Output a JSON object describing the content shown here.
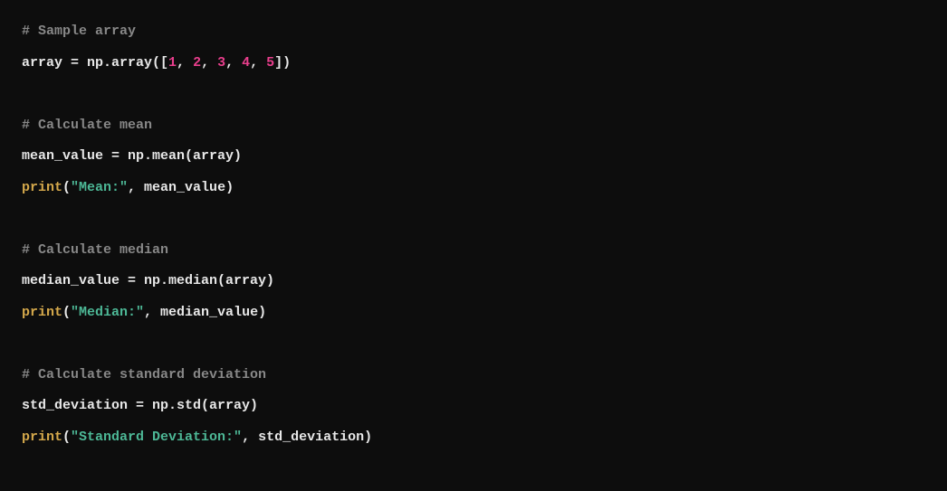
{
  "code": {
    "lines": [
      {
        "type": "comment",
        "content": "# Sample array"
      },
      {
        "type": "mixed",
        "tokens": [
          {
            "c": "default",
            "t": "array = np.array(["
          },
          {
            "c": "number",
            "t": "1"
          },
          {
            "c": "default",
            "t": ", "
          },
          {
            "c": "number",
            "t": "2"
          },
          {
            "c": "default",
            "t": ", "
          },
          {
            "c": "number",
            "t": "3"
          },
          {
            "c": "default",
            "t": ", "
          },
          {
            "c": "number",
            "t": "4"
          },
          {
            "c": "default",
            "t": ", "
          },
          {
            "c": "number",
            "t": "5"
          },
          {
            "c": "default",
            "t": "])"
          }
        ]
      },
      {
        "type": "blank"
      },
      {
        "type": "comment",
        "content": "# Calculate mean"
      },
      {
        "type": "mixed",
        "tokens": [
          {
            "c": "default",
            "t": "mean_value = np.mean(array)"
          }
        ]
      },
      {
        "type": "mixed",
        "tokens": [
          {
            "c": "builtin",
            "t": "print"
          },
          {
            "c": "default",
            "t": "("
          },
          {
            "c": "string",
            "t": "\"Mean:\""
          },
          {
            "c": "default",
            "t": ", mean_value)"
          }
        ]
      },
      {
        "type": "blank"
      },
      {
        "type": "comment",
        "content": "# Calculate median"
      },
      {
        "type": "mixed",
        "tokens": [
          {
            "c": "default",
            "t": "median_value = np.median(array)"
          }
        ]
      },
      {
        "type": "mixed",
        "tokens": [
          {
            "c": "builtin",
            "t": "print"
          },
          {
            "c": "default",
            "t": "("
          },
          {
            "c": "string",
            "t": "\"Median:\""
          },
          {
            "c": "default",
            "t": ", median_value)"
          }
        ]
      },
      {
        "type": "blank"
      },
      {
        "type": "comment",
        "content": "# Calculate standard deviation"
      },
      {
        "type": "mixed",
        "tokens": [
          {
            "c": "default",
            "t": "std_deviation = np.std(array)"
          }
        ]
      },
      {
        "type": "mixed",
        "tokens": [
          {
            "c": "builtin",
            "t": "print"
          },
          {
            "c": "default",
            "t": "("
          },
          {
            "c": "string",
            "t": "\"Standard Deviation:\""
          },
          {
            "c": "default",
            "t": ", std_deviation)"
          }
        ]
      }
    ]
  }
}
